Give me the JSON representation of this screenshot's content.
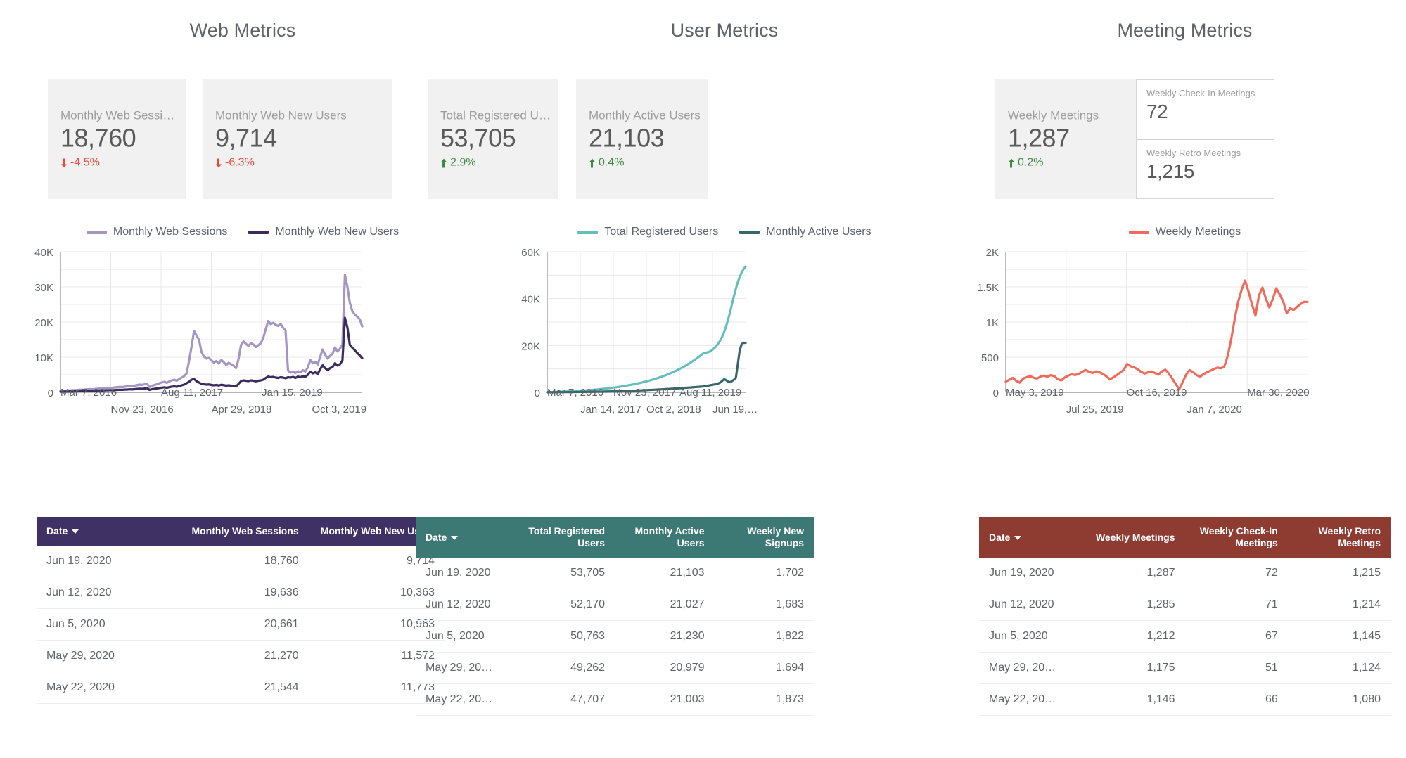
{
  "panels": [
    {
      "title": "Web Metrics",
      "accent": "#3f3164",
      "scorecards": [
        {
          "label": "Monthly Web Sessions",
          "value": "18,760",
          "delta": "-4.5%",
          "direction": "down"
        },
        {
          "label": "Monthly Web New Users",
          "value": "9,714",
          "delta": "-6.3%",
          "direction": "down"
        }
      ],
      "mini_scorecards": [],
      "legend": [
        {
          "label": "Monthly Web Sessions",
          "color": "#a396c4"
        },
        {
          "label": "Monthly Web New Users",
          "color": "#3b2c5e"
        }
      ],
      "table": {
        "columns": [
          "Date",
          "Monthly Web Sessions",
          "Monthly Web New Users"
        ],
        "sorted_column": "Date",
        "rows": [
          [
            "Jun 19, 2020",
            "18,760",
            "9,714"
          ],
          [
            "Jun 12, 2020",
            "19,636",
            "10,363"
          ],
          [
            "Jun 5, 2020",
            "20,661",
            "10,963"
          ],
          [
            "May 29, 2020",
            "21,270",
            "11,572"
          ],
          [
            "May 22, 2020",
            "21,544",
            "11,773"
          ]
        ]
      }
    },
    {
      "title": "User Metrics",
      "accent": "#3c7874",
      "scorecards": [
        {
          "label": "Total Registered Users",
          "value": "53,705",
          "delta": "2.9%",
          "direction": "up"
        },
        {
          "label": "Monthly Active Users",
          "value": "21,103",
          "delta": "0.4%",
          "direction": "up"
        }
      ],
      "mini_scorecards": [],
      "legend": [
        {
          "label": "Total Registered Users",
          "color": "#64bfbc"
        },
        {
          "label": "Monthly Active Users",
          "color": "#37666b"
        }
      ],
      "table": {
        "columns": [
          "Date",
          "Total Registered Users",
          "Monthly Active Users",
          "Weekly New Signups"
        ],
        "sorted_column": "Date",
        "rows": [
          [
            "Jun 19, 2020",
            "53,705",
            "21,103",
            "1,702"
          ],
          [
            "Jun 12, 2020",
            "52,170",
            "21,027",
            "1,683"
          ],
          [
            "Jun 5, 2020",
            "50,763",
            "21,230",
            "1,822"
          ],
          [
            "May 29, 20…",
            "49,262",
            "20,979",
            "1,694"
          ],
          [
            "May 22, 20…",
            "47,707",
            "21,003",
            "1,873"
          ]
        ]
      }
    },
    {
      "title": "Meeting Metrics",
      "accent": "#8e3b32",
      "scorecards": [
        {
          "label": "Weekly Meetings",
          "value": "1,287",
          "delta": "0.2%",
          "direction": "up"
        }
      ],
      "mini_scorecards": [
        {
          "label": "Weekly Check-In Meetings",
          "value": "72"
        },
        {
          "label": "Weekly Retro Meetings",
          "value": "1,215"
        }
      ],
      "legend": [
        {
          "label": "Weekly Meetings",
          "color": "#ef6a5a"
        }
      ],
      "table": {
        "columns": [
          "Date",
          "Weekly Meetings",
          "Weekly Check-In Meetings",
          "Weekly Retro Meetings"
        ],
        "sorted_column": "Date",
        "rows": [
          [
            "Jun 19, 2020",
            "1,287",
            "72",
            "1,215"
          ],
          [
            "Jun 12, 2020",
            "1,285",
            "71",
            "1,214"
          ],
          [
            "Jun 5, 2020",
            "1,212",
            "67",
            "1,145"
          ],
          [
            "May 29, 20…",
            "1,175",
            "51",
            "1,124"
          ],
          [
            "May 22, 20…",
            "1,146",
            "66",
            "1,080"
          ]
        ]
      }
    }
  ],
  "chart_data": [
    {
      "type": "line",
      "title": "Web Metrics",
      "xlabel": "",
      "ylabel": "",
      "ylim": [
        0,
        40000
      ],
      "yticks": [
        0,
        10000,
        20000,
        30000,
        40000
      ],
      "ytick_labels": [
        "0",
        "10K",
        "20K",
        "30K",
        "40K"
      ],
      "gridline_step": 5000,
      "grid": true,
      "legend_position": "top",
      "xtick_labels": [
        "Mar 7, 2016",
        "Nov 23, 2016",
        "Aug 11, 2017",
        "Apr 29, 2018",
        "Jan 15, 2019",
        "Oct 3, 2019"
      ],
      "series": [
        {
          "name": "Monthly Web Sessions",
          "color": "#a396c4",
          "values": [
            350,
            420,
            500,
            470,
            560,
            640,
            600,
            700,
            760,
            720,
            800,
            880,
            920,
            870,
            960,
            1040,
            1100,
            1050,
            1180,
            1260,
            1340,
            1290,
            1400,
            1480,
            1560,
            1500,
            1620,
            1700,
            1820,
            1760,
            1900,
            2050,
            2200,
            2120,
            2300,
            2480,
            1500,
            1900,
            2100,
            2300,
            2600,
            2800,
            3000,
            2700,
            3100,
            3400,
            3600,
            3300,
            3800,
            4200,
            4600,
            5400,
            9000,
            13000,
            17500,
            16200,
            15000,
            11500,
            10200,
            9600,
            9800,
            9100,
            8500,
            8900,
            8200,
            9200,
            8600,
            7800,
            8400,
            8000,
            7600,
            6900,
            9500,
            13500,
            14500,
            13800,
            13200,
            14000,
            13600,
            12900,
            13400,
            14000,
            15500,
            18000,
            20300,
            19400,
            19800,
            19200,
            18900,
            19500,
            18400,
            17600,
            6200,
            5600,
            5900,
            5500,
            6000,
            5700,
            6300,
            5900,
            7100,
            9200,
            8300,
            8700,
            7900,
            10100,
            12200,
            10700,
            9600,
            10400,
            11000,
            12800,
            11600,
            12400,
            13600,
            33500,
            30000,
            25500,
            23000,
            22200,
            21500,
            20800,
            18760
          ]
        },
        {
          "name": "Monthly Web New Users",
          "color": "#3b2c5e",
          "values": [
            180,
            210,
            240,
            230,
            270,
            300,
            290,
            330,
            360,
            340,
            380,
            420,
            440,
            410,
            460,
            490,
            520,
            500,
            560,
            600,
            640,
            610,
            660,
            700,
            740,
            710,
            770,
            800,
            860,
            830,
            900,
            970,
            1040,
            1000,
            1090,
            1180,
            700,
            900,
            1000,
            1100,
            1250,
            1340,
            1440,
            1290,
            1480,
            1620,
            1720,
            1580,
            1820,
            2000,
            2200,
            2600,
            3000,
            3600,
            3800,
            3200,
            2800,
            2400,
            2300,
            2200,
            2250,
            2100,
            2000,
            2100,
            1950,
            2150,
            2050,
            1900,
            2000,
            1900,
            1850,
            1700,
            2400,
            3200,
            3400,
            3300,
            3200,
            3400,
            3300,
            3150,
            3300,
            3400,
            3600,
            4100,
            4500,
            4300,
            4400,
            4200,
            4100,
            4300,
            4200,
            4000,
            4300,
            4200,
            4400,
            4100,
            4500,
            4300,
            4600,
            4400,
            5000,
            5900,
            5400,
            5700,
            5200,
            6600,
            7700,
            6900,
            6300,
            6900,
            7200,
            8300,
            7600,
            8000,
            9100,
            21200,
            18500,
            13500,
            12700,
            12000,
            11200,
            10500,
            9714
          ]
        }
      ]
    },
    {
      "type": "line",
      "title": "User Metrics",
      "xlabel": "",
      "ylabel": "",
      "ylim": [
        0,
        60000
      ],
      "yticks": [
        0,
        20000,
        40000,
        60000
      ],
      "ytick_labels": [
        "0",
        "20K",
        "40K",
        "60K"
      ],
      "gridline_step": 10000,
      "grid": true,
      "legend_position": "top",
      "xtick_labels": [
        "Mar 7, 2016",
        "Jan 14, 2017",
        "Nov 23, 2017",
        "Oct 2, 2018",
        "Aug 11, 2019",
        "Jun 19,…"
      ],
      "series": [
        {
          "name": "Total Registered Users",
          "color": "#64bfbc",
          "values": [
            60,
            80,
            100,
            130,
            160,
            190,
            220,
            250,
            290,
            330,
            370,
            410,
            450,
            490,
            530,
            580,
            630,
            680,
            730,
            790,
            850,
            910,
            970,
            1040,
            1110,
            1180,
            1260,
            1340,
            1420,
            1510,
            1600,
            1700,
            1800,
            1900,
            2010,
            2120,
            2240,
            2360,
            2490,
            2620,
            2760,
            2900,
            3050,
            3200,
            3360,
            3520,
            3700,
            3880,
            4070,
            4260,
            4470,
            4680,
            4900,
            5130,
            5370,
            5620,
            5880,
            6150,
            6430,
            6720,
            7020,
            7340,
            7670,
            8010,
            8370,
            8740,
            9130,
            9530,
            9950,
            10390,
            10840,
            11310,
            11800,
            12310,
            12840,
            13390,
            13960,
            14550,
            15170,
            15810,
            16470,
            16900,
            17000,
            17200,
            17600,
            18200,
            18900,
            19800,
            20900,
            22200,
            23800,
            25800,
            28200,
            31000,
            34200,
            37600,
            41000,
            44200,
            47000,
            49300,
            51200,
            52600,
            53705
          ]
        },
        {
          "name": "Monthly Active Users",
          "color": "#37666b",
          "values": [
            40,
            45,
            50,
            55,
            60,
            65,
            70,
            78,
            85,
            92,
            100,
            108,
            116,
            124,
            132,
            142,
            152,
            162,
            172,
            184,
            196,
            208,
            220,
            234,
            248,
            262,
            278,
            294,
            310,
            328,
            346,
            366,
            386,
            406,
            428,
            450,
            474,
            498,
            524,
            550,
            578,
            606,
            636,
            666,
            698,
            730,
            764,
            798,
            834,
            870,
            908,
            946,
            986,
            1026,
            1068,
            1110,
            1154,
            1198,
            1244,
            1290,
            1338,
            1386,
            1436,
            1486,
            1538,
            1590,
            1644,
            1698,
            1754,
            1810,
            1868,
            1926,
            1986,
            2046,
            2108,
            2170,
            2234,
            2298,
            2364,
            2430,
            2498,
            2600,
            2750,
            2900,
            3050,
            3200,
            3350,
            3550,
            3800,
            4200,
            4900,
            5600,
            5200,
            4600,
            4300,
            4800,
            5400,
            6200,
            12000,
            18000,
            20600,
            21200,
            21103
          ]
        }
      ]
    },
    {
      "type": "line",
      "title": "Meeting Metrics",
      "xlabel": "",
      "ylabel": "",
      "ylim": [
        0,
        2000
      ],
      "yticks": [
        0,
        500,
        1000,
        1500,
        2000
      ],
      "ytick_labels": [
        "0",
        "500",
        "1K",
        "1.5K",
        "2K"
      ],
      "gridline_step": 250,
      "grid": true,
      "legend_position": "top",
      "xtick_labels": [
        "May 3, 2019",
        "Jul 25, 2019",
        "Oct 16, 2019",
        "Jan 7, 2020",
        "Mar 30, 2020"
      ],
      "series": [
        {
          "name": "Weekly Meetings",
          "color": "#ef6a5a",
          "values": [
            152,
            178,
            205,
            165,
            138,
            196,
            215,
            232,
            208,
            196,
            224,
            238,
            222,
            245,
            230,
            186,
            170,
            212,
            238,
            258,
            246,
            262,
            290,
            318,
            292,
            276,
            298,
            286,
            262,
            228,
            186,
            212,
            246,
            282,
            318,
            404,
            372,
            356,
            330,
            292,
            268,
            284,
            298,
            276,
            252,
            298,
            322,
            268,
            196,
            118,
            42,
            146,
            252,
            316,
            288,
            246,
            222,
            258,
            286,
            308,
            332,
            352,
            342,
            368,
            520,
            760,
            1040,
            1290,
            1460,
            1590,
            1430,
            1250,
            1092,
            1380,
            1490,
            1330,
            1208,
            1330,
            1480,
            1392,
            1290,
            1124,
            1196,
            1172,
            1216,
            1256,
            1288,
            1287
          ]
        }
      ]
    }
  ]
}
